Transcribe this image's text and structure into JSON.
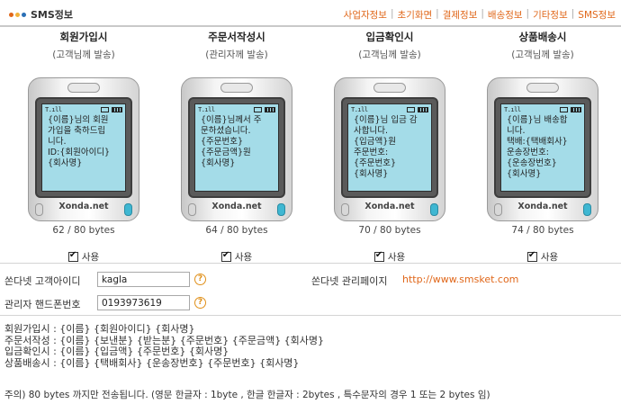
{
  "header": {
    "title": "SMS정보",
    "nav": [
      "사업자정보",
      "초기화면",
      "결제정보",
      "배송정보",
      "기타정보",
      "SMS정보"
    ]
  },
  "colors": {
    "accent": "#e0671a",
    "screen": "#a4dce8",
    "dot1": "#e0671a",
    "dot2": "#f2b23a",
    "dot3": "#2a6fb6"
  },
  "phones": [
    {
      "title": "회원가입시",
      "subtitle": "(고객님께 발송)",
      "message": "{이름}님의 회원\n가입을 축하드립\n니다.\nID:{회원아이디}\n{회사명}",
      "brand": "Xonda.net",
      "bytes": "62 / 80 bytes",
      "use_label": "사용",
      "checked": true
    },
    {
      "title": "주문서작성시",
      "subtitle": "(관리자께 발송)",
      "message": "{이름}님께서 주\n문하셨습니다.\n{주문번호}\n{주문금액}원\n{회사명}",
      "brand": "Xonda.net",
      "bytes": "64 / 80 bytes",
      "use_label": "사용",
      "checked": true
    },
    {
      "title": "입금확인시",
      "subtitle": "(고객님께 발송)",
      "message": "{이름}님 입금 감\n사합니다.\n{입금액}원\n주문번호:\n{주문번호}\n{회사명}",
      "brand": "Xonda.net",
      "bytes": "70 / 80 bytes",
      "use_label": "사용",
      "checked": true
    },
    {
      "title": "상품배송시",
      "subtitle": "(고객님께 발송)",
      "message": "{이름}님 배송합\n니다.\n택배:{택배회사}\n운송장번호:\n{운송장번호}\n{회사명}",
      "brand": "Xonda.net",
      "bytes": "74 / 80 bytes",
      "use_label": "사용",
      "checked": true
    }
  ],
  "form": {
    "customer_id_label": "쏜다넷 고객아이디",
    "customer_id_value": "kagla",
    "admin_page_label": "쏜다넷 관리페이지",
    "admin_page_url": "http://www.smsket.com",
    "admin_phone_label": "관리자 핸드폰번호",
    "admin_phone_value": "0193973619",
    "help_glyph": "?"
  },
  "notes": [
    "회원가입시 : {이름} {회원아이디} {회사명}",
    "주문서작성 : {이름} {보낸분} {받는분} {주문번호} {주문금액} {회사명}",
    "입금확인시 : {이름} {입금액} {주문번호} {회사명}",
    "상품배송시 : {이름} {택배회사} {운송장번호} {주문번호} {회사명}"
  ],
  "footer_note": "주의) 80 bytes 까지만 전송됩니다. (영문 한글자 : 1byte , 한글 한글자 : 2bytes , 특수문자의 경우 1 또는 2 bytes 임)"
}
